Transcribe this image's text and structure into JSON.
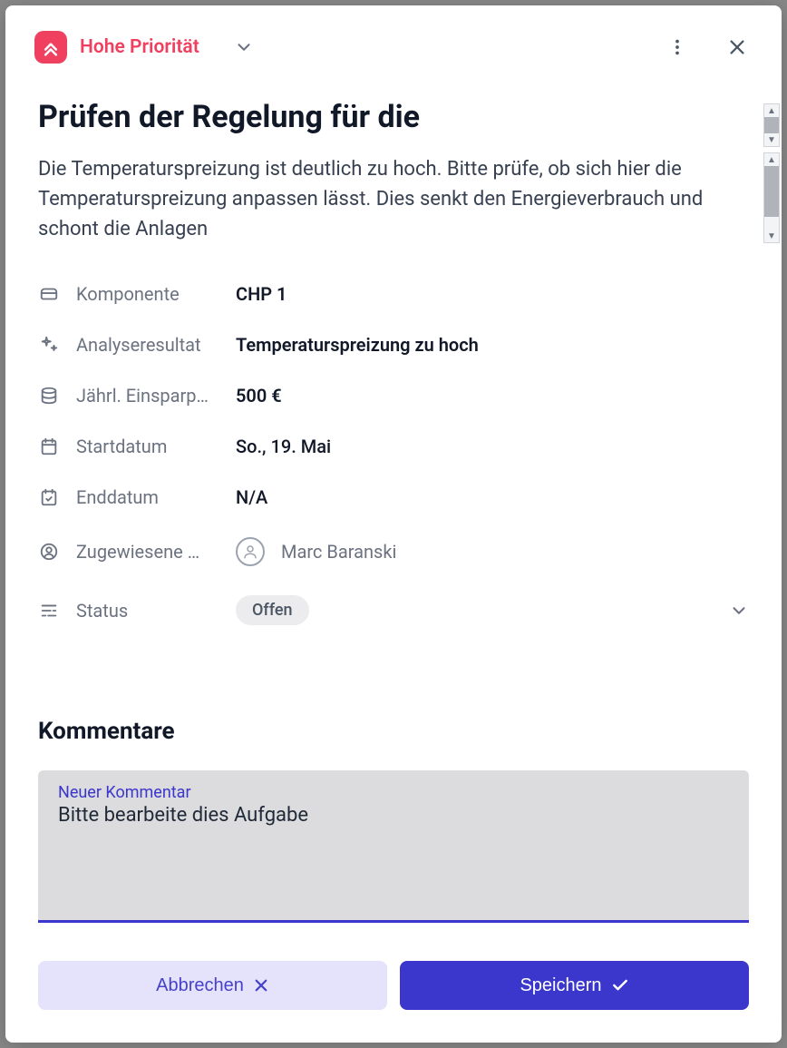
{
  "header": {
    "priority_label": "Hohe Priorität"
  },
  "title": "Prüfen der Regelung für die",
  "description": "Die Temperaturspreizung ist deutlich zu hoch. Bitte prüfe, ob sich hier die Temperaturspreizung anpassen lässt. Dies senkt den Energieverbrauch und schont die Anlagen",
  "fields": {
    "component": {
      "label": "Komponente",
      "value": "CHP 1"
    },
    "analysis": {
      "label": "Analyseresultat",
      "value": "Temperaturspreizung zu hoch"
    },
    "savings": {
      "label": "Jährl. Einsparp…",
      "value": "500 €"
    },
    "start": {
      "label": "Startdatum",
      "value": "So., 19. Mai"
    },
    "end": {
      "label": "Enddatum",
      "value": "N/A"
    },
    "assignee": {
      "label": "Zugewiesene …",
      "value": "Marc Baranski"
    },
    "status": {
      "label": "Status",
      "value": "Offen"
    }
  },
  "comments": {
    "section_title": "Kommentare",
    "input_label": "Neuer Kommentar",
    "input_value": "Bitte bearbeite dies Aufgabe"
  },
  "footer": {
    "cancel": "Abbrechen",
    "save": "Speichern"
  }
}
